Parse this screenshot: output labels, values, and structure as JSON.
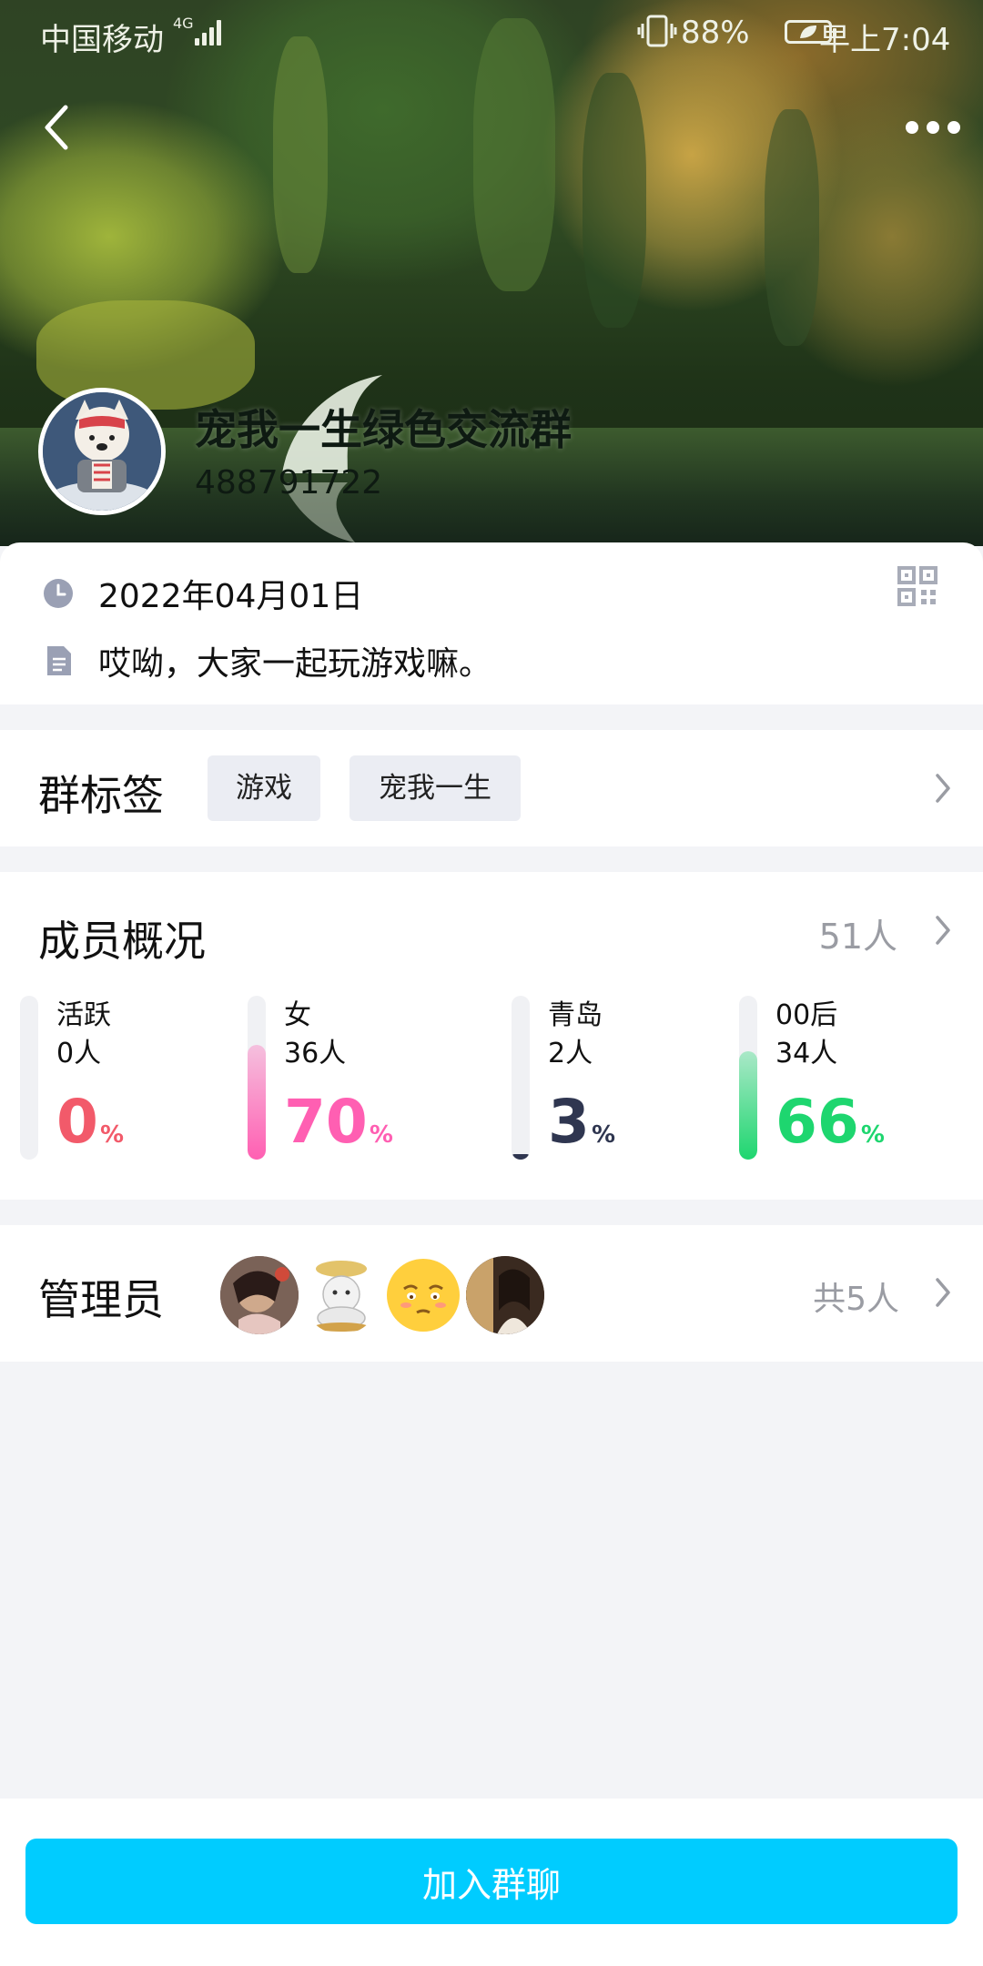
{
  "status_bar": {
    "carrier": "中国移动",
    "network": "4G",
    "battery": "88%",
    "time": "早上7:04"
  },
  "group": {
    "name": "宠我一生绿色交流群",
    "id": "488791722"
  },
  "info": {
    "date": "2022年04月01日",
    "description": "哎呦，大家一起玩游戏嘛。"
  },
  "tags": {
    "title": "群标签",
    "items": [
      "游戏",
      "宠我一生"
    ]
  },
  "members": {
    "title": "成员概况",
    "total": "51人",
    "stats": [
      {
        "label": "活跃",
        "count": "0人",
        "percent": "0",
        "unit": "%",
        "value": 0,
        "color": "#f25a6a"
      },
      {
        "label": "女",
        "count": "36人",
        "percent": "70",
        "unit": "%",
        "value": 70,
        "color": "#ff5fb2"
      },
      {
        "label": "青岛",
        "count": "2人",
        "percent": "3",
        "unit": "%",
        "value": 3,
        "color": "#2f3650"
      },
      {
        "label": "00后",
        "count": "34人",
        "percent": "66",
        "unit": "%",
        "value": 66,
        "color": "#1ed66f"
      }
    ]
  },
  "admins": {
    "title": "管理员",
    "total": "共5人"
  },
  "actions": {
    "join": "加入群聊"
  },
  "colors": {
    "accent": "#00ccff",
    "background": "#f3f4f7"
  }
}
